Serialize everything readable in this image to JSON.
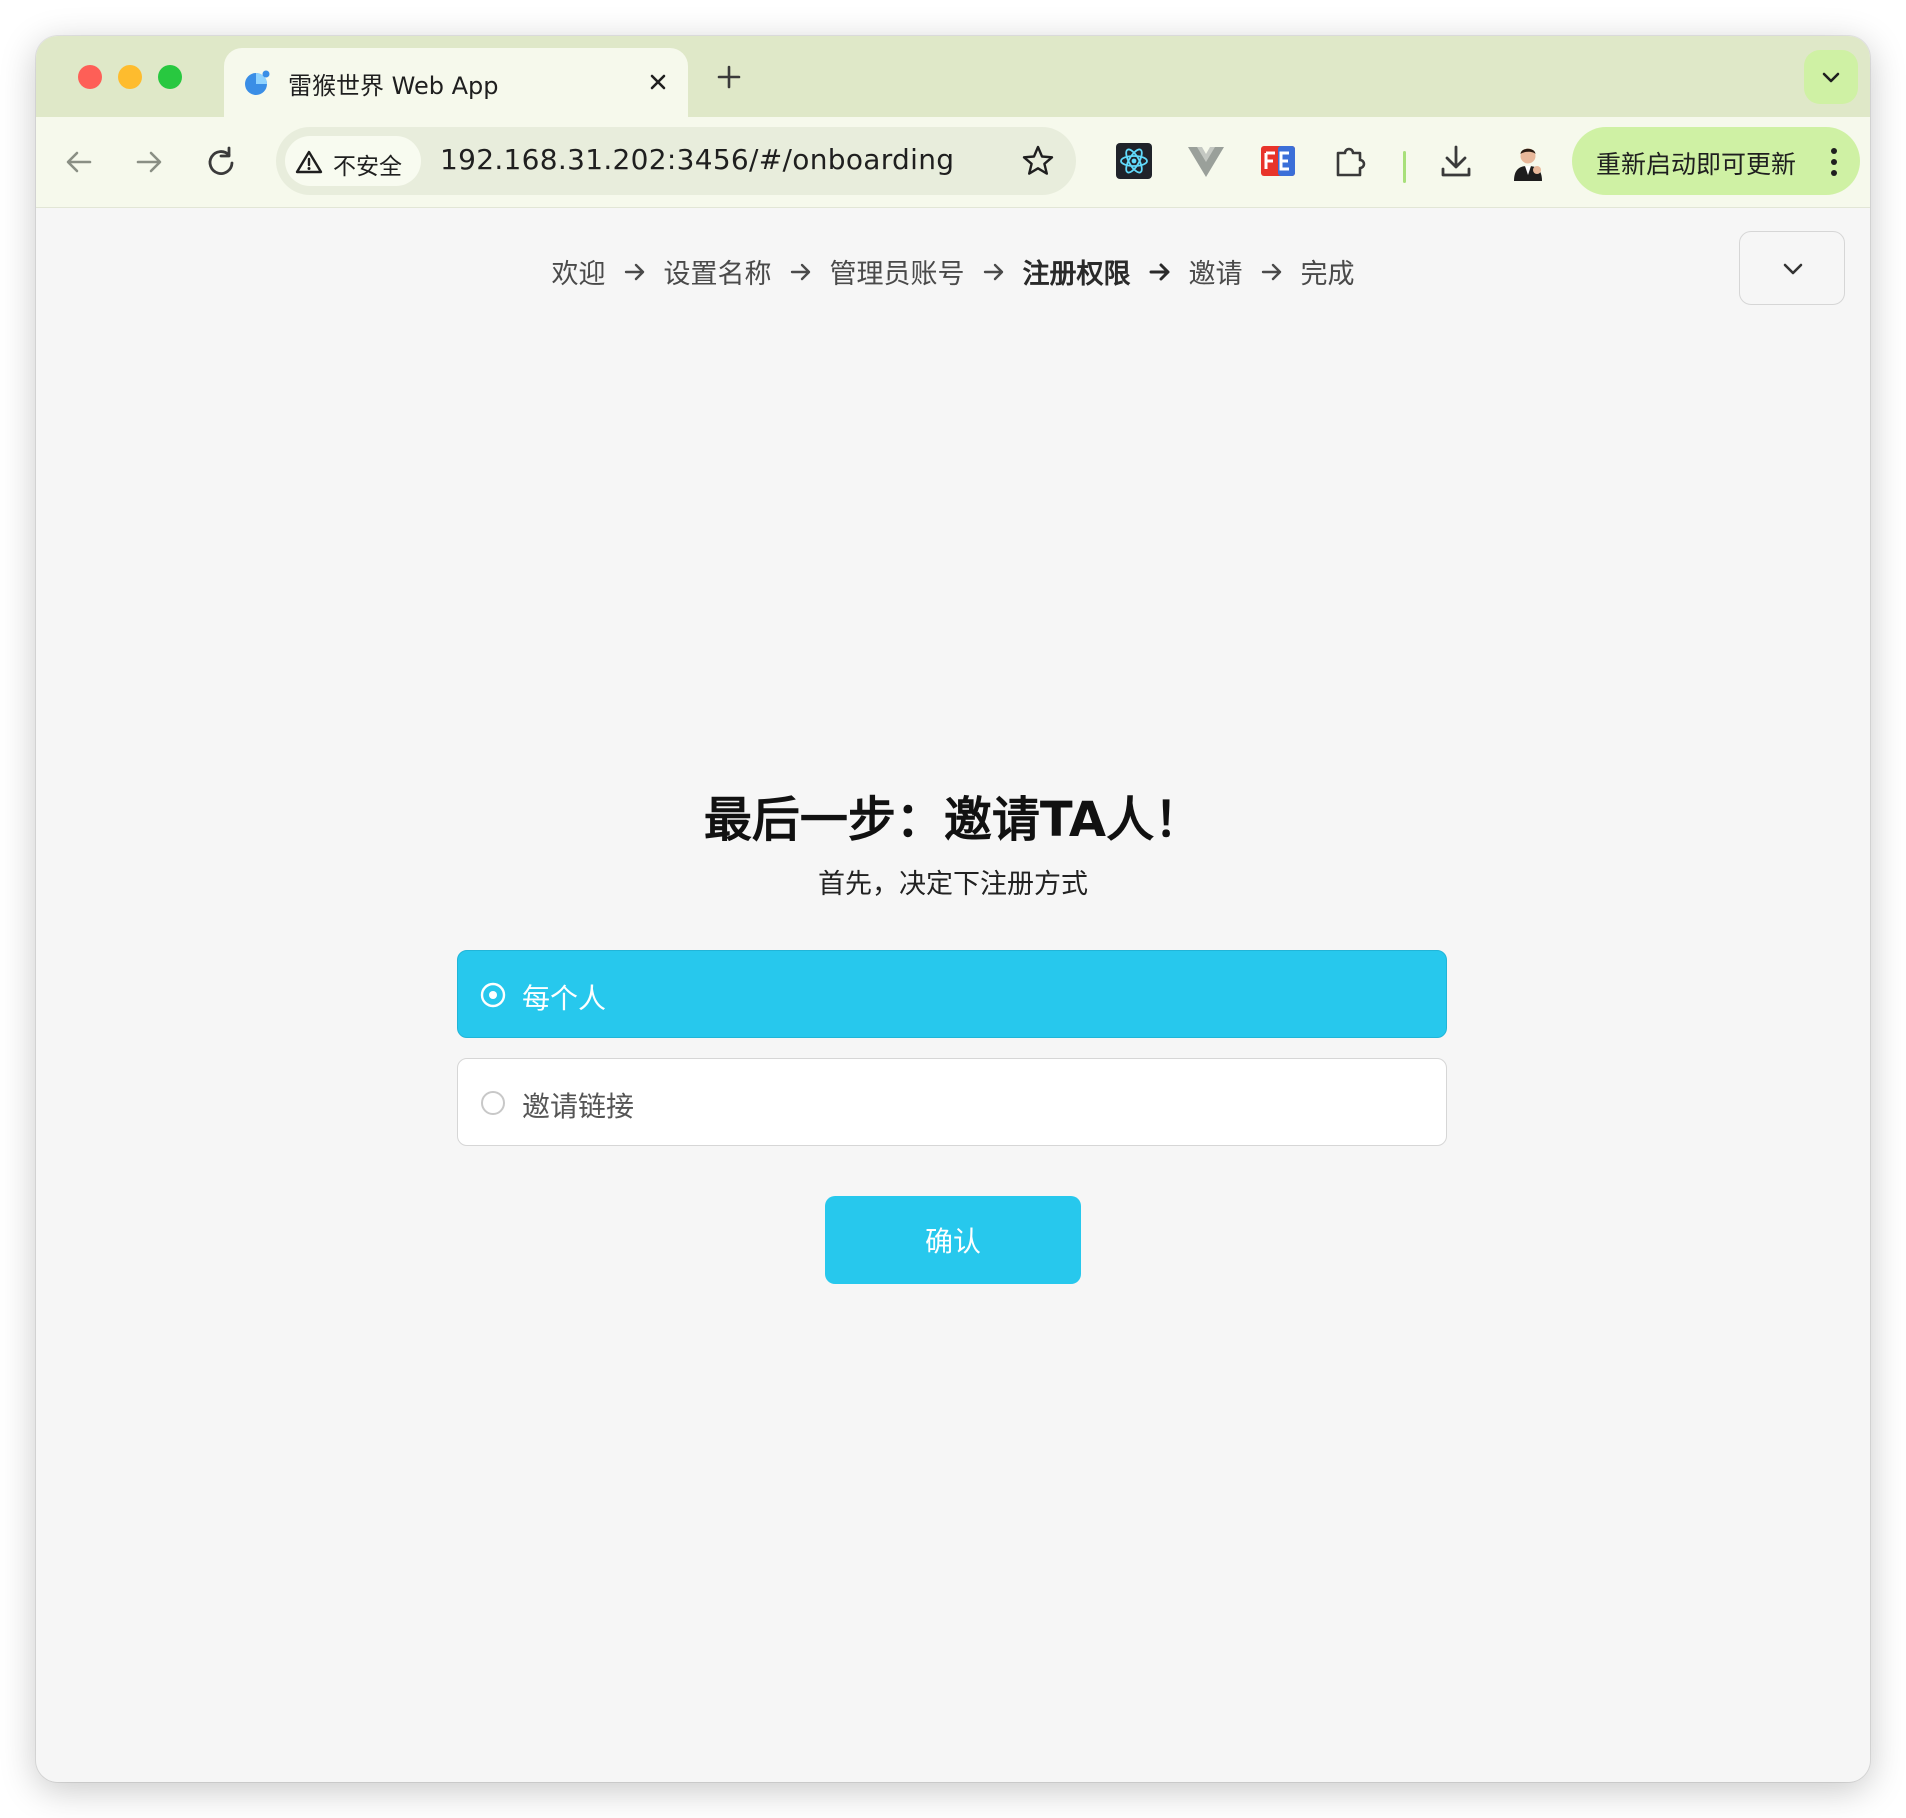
{
  "browser": {
    "tab": {
      "title": "雷猴世界 Web App"
    },
    "address": {
      "security_label": "不安全",
      "url": "192.168.31.202:3456/#/onboarding"
    },
    "update_button": {
      "label": "重新启动即可更新"
    }
  },
  "onboarding": {
    "steps": [
      {
        "label": "欢迎"
      },
      {
        "label": "设置名称"
      },
      {
        "label": "管理员账号"
      },
      {
        "label": "注册权限",
        "active": true
      },
      {
        "label": "邀请"
      },
      {
        "label": "完成"
      }
    ],
    "title": "最后一步：邀请TA人！",
    "subtitle": "首先，决定下注册方式",
    "options": [
      {
        "label": "每个人",
        "selected": true
      },
      {
        "label": "邀请链接",
        "selected": false
      }
    ],
    "confirm_label": "确认"
  },
  "colors": {
    "accent": "#27c8ed",
    "tabstrip": "#dfe8c8",
    "toolbar": "#f6f9ec",
    "update_button": "#cff1a4",
    "page_background": "#f6f6f6"
  }
}
